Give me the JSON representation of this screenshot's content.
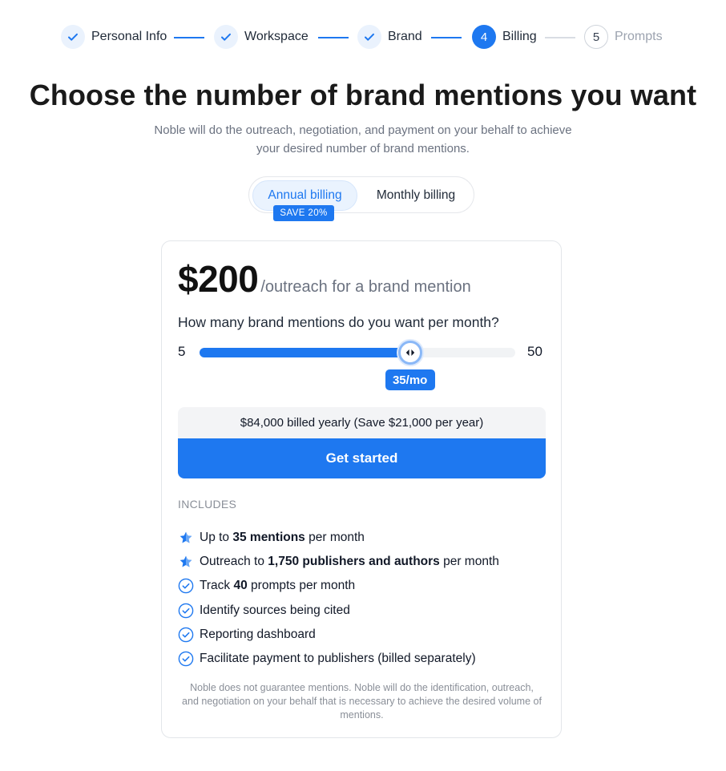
{
  "stepper": {
    "steps": [
      {
        "label": "Personal Info",
        "status": "done"
      },
      {
        "label": "Workspace",
        "status": "done"
      },
      {
        "label": "Brand",
        "status": "done"
      },
      {
        "number": "4",
        "label": "Billing",
        "status": "active"
      },
      {
        "number": "5",
        "label": "Prompts",
        "status": "pending"
      }
    ]
  },
  "headline": "Choose the number of brand mentions you want",
  "subtext": "Noble will do the outreach, negotiation, and payment on your behalf to achieve your desired number of brand mentions.",
  "billing_toggle": {
    "options": [
      "Annual billing",
      "Monthly billing"
    ],
    "selected": "Annual billing",
    "badge": "SAVE 20%"
  },
  "card": {
    "price_amount": "$200",
    "price_unit": "/outreach for a brand mention",
    "question": "How many brand mentions do you want per month?",
    "slider": {
      "min_label": "5",
      "max_label": "50",
      "min": 5,
      "max": 50,
      "value": 35,
      "value_label": "35/mo"
    },
    "billed_text": "$84,000 billed yearly (Save $21,000 per year)",
    "cta_label": "Get started",
    "includes_title": "INCLUDES",
    "features": [
      {
        "icon": "star-icon",
        "parts": [
          [
            "Up to ",
            false
          ],
          [
            "35 mentions",
            true
          ],
          [
            " per month",
            false
          ]
        ]
      },
      {
        "icon": "star-icon",
        "parts": [
          [
            "Outreach to ",
            false
          ],
          [
            "1,750 publishers and authors",
            true
          ],
          [
            " per month",
            false
          ]
        ]
      },
      {
        "icon": "check-circle-icon",
        "parts": [
          [
            "Track ",
            false
          ],
          [
            "40",
            true
          ],
          [
            " prompts per month",
            false
          ]
        ]
      },
      {
        "icon": "check-circle-icon",
        "parts": [
          [
            "Identify sources being cited",
            false
          ]
        ]
      },
      {
        "icon": "check-circle-icon",
        "parts": [
          [
            "Reporting dashboard",
            false
          ]
        ]
      },
      {
        "icon": "check-circle-icon",
        "parts": [
          [
            "Facilitate payment to publishers (billed separately)",
            false
          ]
        ]
      }
    ],
    "disclaimer": "Noble does not guarantee mentions. Noble will do the identification, outreach, and negotiation on your behalf that is necessary to achieve the desired volume of mentions."
  },
  "colors": {
    "accent": "#1e78f0",
    "accent_light": "#eaf3fe",
    "star": "#1e78f0"
  }
}
